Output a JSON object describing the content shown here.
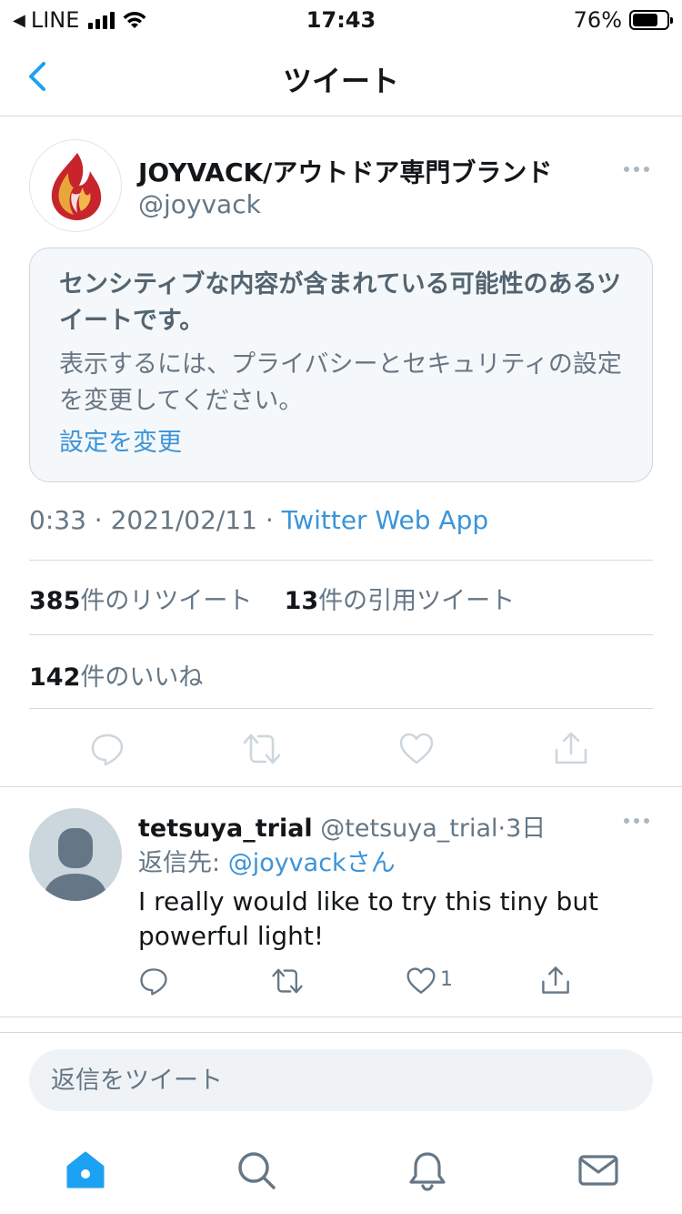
{
  "status_bar": {
    "carrier": "LINE",
    "time": "17:43",
    "battery": "76%",
    "battery_level": 0.76
  },
  "nav": {
    "title": "ツイート"
  },
  "tweet": {
    "author_name": "JOYVACK/アウトドア専門ブランド",
    "author_handle": "@joyvack",
    "sensitive": {
      "title": "センシティブな内容が含まれている可能性のあるツイートです。",
      "description": "表示するには、プライバシーとセキュリティの設定を変更してください。",
      "link": "設定を変更"
    },
    "time": "0:33",
    "date": "2021/02/11",
    "source": "Twitter Web App",
    "retweet_count": "385",
    "retweet_label": "件のリツイート",
    "quote_count": "13",
    "quote_label": "件の引用ツイート",
    "like_count": "142",
    "like_label": "件のいいね"
  },
  "reply": {
    "name": "tetsuya_trial",
    "handle": "@tetsuya_trial",
    "age": "3日",
    "reply_to_label": "返信先: ",
    "reply_to_user": "@joyvackさん",
    "text": "I really would like to try this tiny but powerful light!",
    "like_count": "1"
  },
  "composer": {
    "placeholder": "返信をツイート"
  },
  "colors": {
    "accent": "#1da1f2",
    "link": "#3b94d9",
    "muted": "#657786"
  }
}
